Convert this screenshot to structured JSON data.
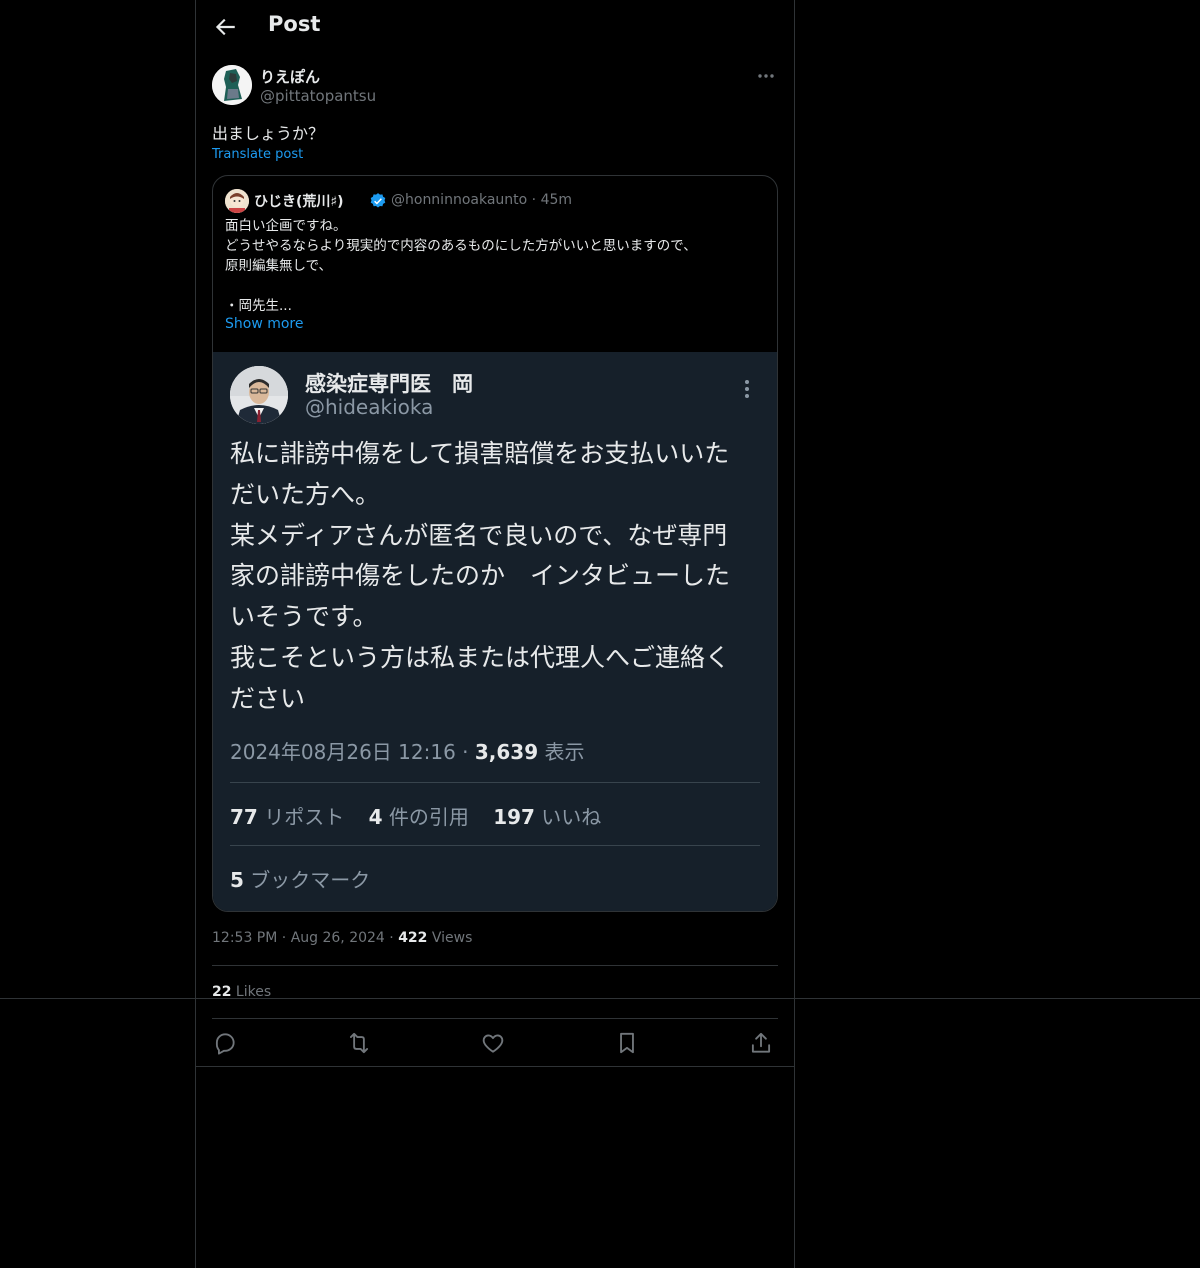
{
  "header": {
    "title": "Post",
    "back_icon": "arrow-left-icon"
  },
  "author": {
    "name": "りえぽん",
    "handle": "@pittatopantsu"
  },
  "post": {
    "text": "出ましょうか？",
    "translate_label": "Translate post"
  },
  "quote": {
    "name": "ひじき(荒川♯)",
    "handle": "@honninnoakaunto",
    "separator": "·",
    "time": "45m",
    "lines": [
      "面白い企画ですね。",
      "どうせやるならより現実的で内容のあるものにした方がいいと思いますので、",
      "原則編集無しで、",
      "",
      "・岡先生..."
    ],
    "show_more": "Show more",
    "screenshot": {
      "name": "感染症専門医　岡",
      "handle": "@hideakioka",
      "text_lines": [
        "私に誹謗中傷をして損害賠償をお支払いいた",
        "だいた方へ。",
        "某メディアさんが匿名で良いので、なぜ専門",
        "家の誹謗中傷をしたのか　インタビューした",
        "いそうです。",
        "我こそという方は私または代理人へご連絡く",
        "ださい"
      ],
      "datetime": "2024年08月26日 12:16 · ",
      "views_count": "3,639",
      "views_label": " 表示",
      "reposts_count": "77",
      "reposts_label": " リポスト",
      "quotes_count": "4",
      "quotes_label": " 件の引用",
      "likes_count": "197",
      "likes_label": " いいね",
      "bookmarks_count": "5",
      "bookmarks_label": " ブックマーク"
    }
  },
  "meta": {
    "time": "12:53 PM",
    "dot": " · ",
    "date": "Aug 26, 2024",
    "views_count": "422",
    "views_label": " Views",
    "likes_count": "22",
    "likes_label": " Likes"
  },
  "actions": [
    "reply-icon",
    "repost-icon",
    "like-icon",
    "bookmark-icon",
    "share-icon"
  ],
  "colors": {
    "background": "#000000",
    "link": "#1d9bf0",
    "muted": "#71767b",
    "border": "#2f3336",
    "screenshot_bg": "#16202a"
  }
}
